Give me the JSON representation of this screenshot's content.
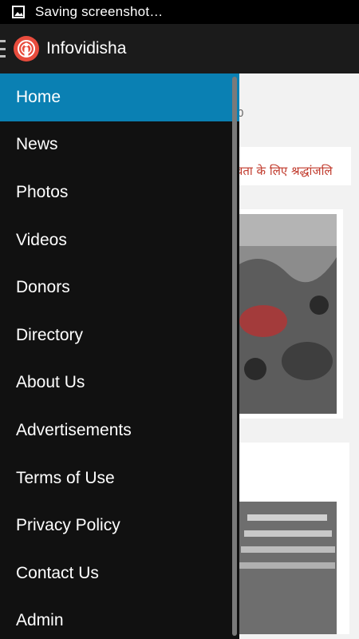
{
  "status_bar": {
    "text": "Saving screenshot…",
    "icon": "image-icon"
  },
  "app_bar": {
    "title": "Infovidisha",
    "menu_icon": "hamburger-icon",
    "logo_icon": "app-logo-icon"
  },
  "background_content": {
    "meta": "0",
    "headline": "वता के लिए श्रद्धांजलि"
  },
  "drawer": {
    "items": [
      {
        "label": "Home",
        "active": true
      },
      {
        "label": "News"
      },
      {
        "label": "Photos"
      },
      {
        "label": "Videos"
      },
      {
        "label": "Donors"
      },
      {
        "label": "Directory"
      },
      {
        "label": "About Us"
      },
      {
        "label": "Advertisements"
      },
      {
        "label": "Terms of Use"
      },
      {
        "label": "Privacy Policy"
      },
      {
        "label": "Contact Us"
      },
      {
        "label": "Admin"
      }
    ]
  },
  "colors": {
    "accent": "#0a80b3",
    "drawer_bg": "#111111",
    "headline": "#c0392b"
  }
}
